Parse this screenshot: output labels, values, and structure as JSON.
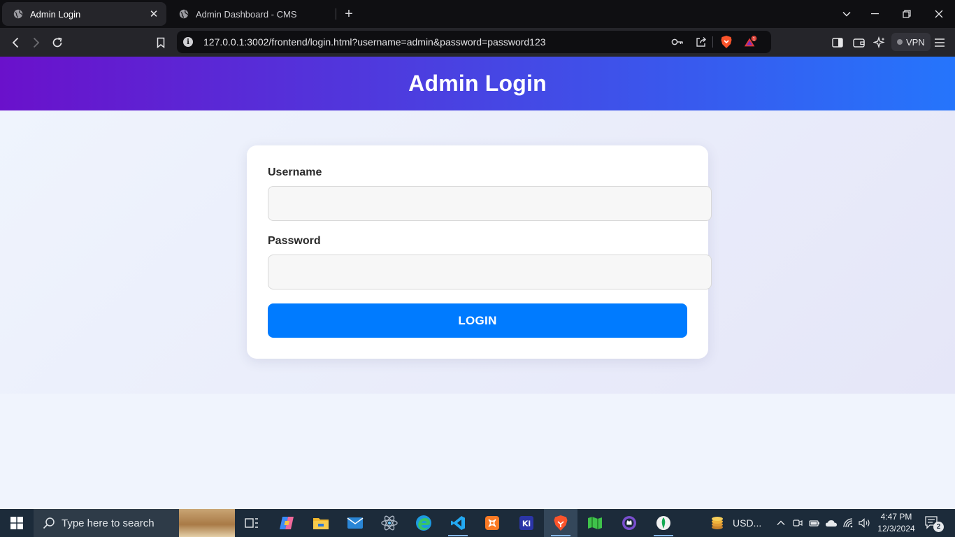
{
  "browser": {
    "tabs": [
      {
        "title": "Admin Login",
        "active": true
      },
      {
        "title": "Admin Dashboard - CMS",
        "active": false
      }
    ],
    "url": "127.0.0.1:3002/frontend/login.html?username=admin&password=password123",
    "shield_badge_count": "1",
    "vpn_label": "VPN"
  },
  "page": {
    "header_title": "Admin Login",
    "form": {
      "username_label": "Username",
      "username_value": "",
      "password_label": "Password",
      "password_value": "",
      "submit_label": "LOGIN"
    }
  },
  "taskbar": {
    "search_placeholder": "Type here to search",
    "tray_app_label": "USD...",
    "time": "4:47 PM",
    "date": "12/3/2024",
    "notification_count": "2"
  },
  "colors": {
    "header_gradient_start": "#6a11cb",
    "header_gradient_end": "#2575fc",
    "login_button": "#007bff",
    "page_background": "#eff4fd"
  }
}
